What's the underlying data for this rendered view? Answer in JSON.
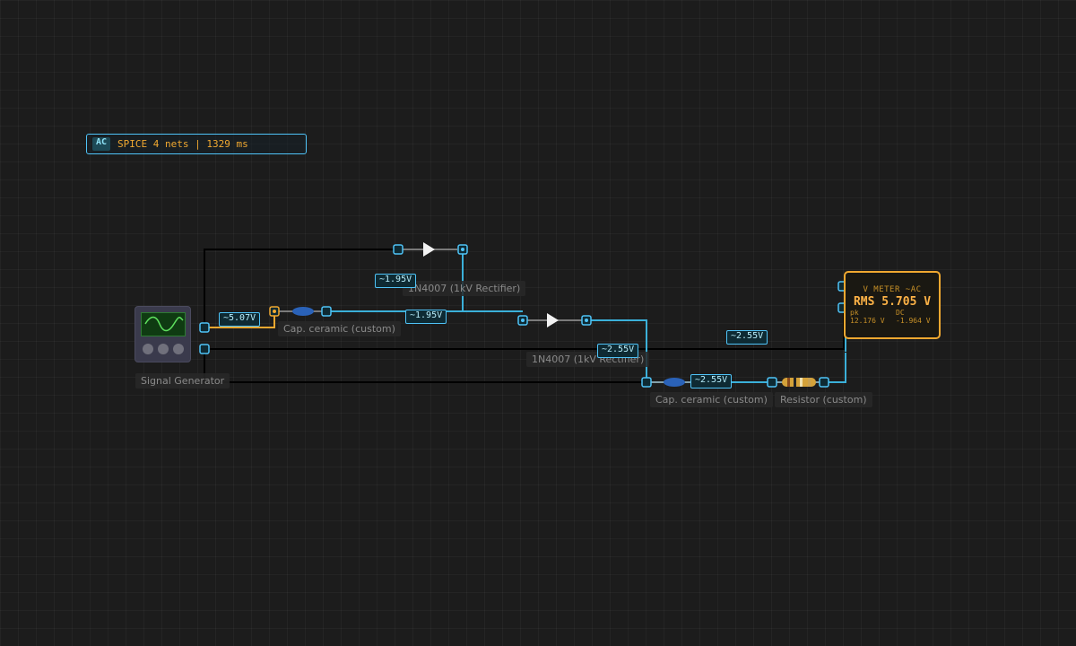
{
  "sim_badge": {
    "mode": "AC",
    "status": "SPICE 4 nets | 1329 ms"
  },
  "components": {
    "signal_generator": "Signal Generator",
    "capacitor_1": "Cap. ceramic (custom)",
    "capacitor_2": "Cap. ceramic (custom)",
    "diode_1": "1N4007 (1kV Rectifier)",
    "diode_2": "1N4007 (1kV Rectifier)",
    "resistor": "Resistor (custom)"
  },
  "voltages": {
    "gen_out": "~5.07V",
    "node_top": "~1.95V",
    "node_mid": "~1.95V",
    "node_d2": "~2.55V",
    "node_meter": "~2.55V",
    "node_cap2": "~2.55V"
  },
  "meter": {
    "title": "V METER ~AC",
    "rms": "RMS 5.705 V",
    "pk_label": "pk",
    "pk_value": "12.176 V",
    "dc_label": "DC",
    "dc_value": "-1.964 V"
  },
  "colors": {
    "active_wire": "#3bb0d9",
    "ground_wire": "#000000",
    "source_wire": "#f0a830",
    "meter_accent": "#f0a830"
  }
}
